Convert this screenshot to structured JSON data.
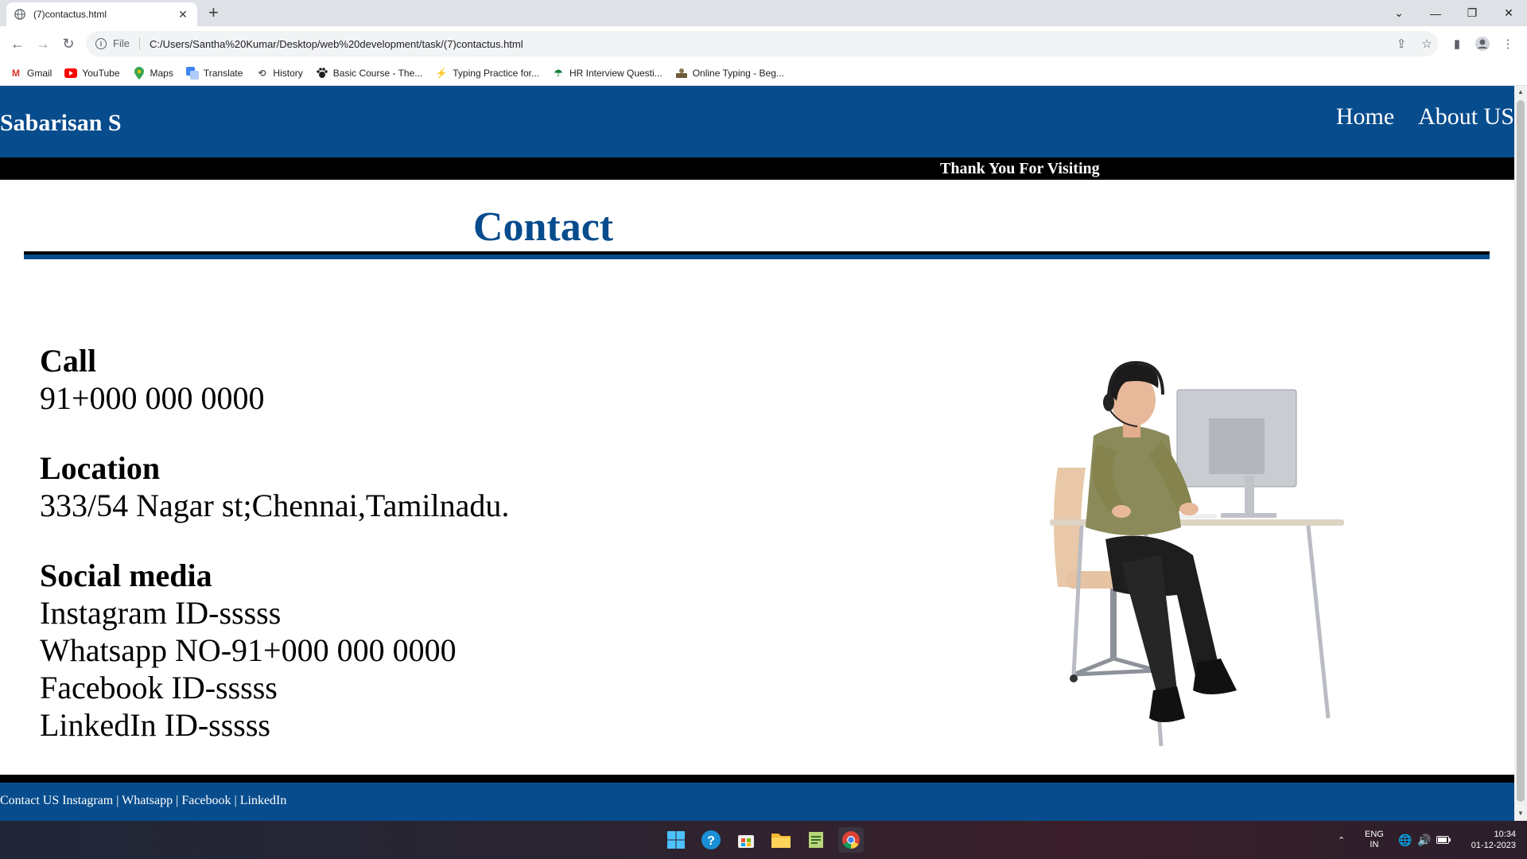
{
  "browser": {
    "tab_title": "(7)contactus.html",
    "url_scheme": "File",
    "url": "C:/Users/Santha%20Kumar/Desktop/web%20development/task/(7)contactus.html",
    "bookmarks": [
      {
        "label": "Gmail",
        "icon": "gmail-icon"
      },
      {
        "label": "YouTube",
        "icon": "youtube-icon"
      },
      {
        "label": "Maps",
        "icon": "maps-icon"
      },
      {
        "label": "Translate",
        "icon": "translate-icon"
      },
      {
        "label": "History",
        "icon": "history-icon"
      },
      {
        "label": "Basic Course - The...",
        "icon": "paw-icon"
      },
      {
        "label": "Typing Practice for...",
        "icon": "bolt-icon"
      },
      {
        "label": "HR Interview Questi...",
        "icon": "palm-icon"
      },
      {
        "label": "Online Typing - Beg...",
        "icon": "typing-icon"
      }
    ]
  },
  "site": {
    "brand": "Sabarisan S",
    "nav": [
      "Home",
      "About US"
    ],
    "ticker": "Thank You For Visiting",
    "page_title": "Contact",
    "sections": {
      "call_heading": "Call",
      "call_value": "91+000 000 0000",
      "location_heading": "Location",
      "location_value": "333/54 Nagar st;Chennai,Tamilnadu.",
      "social_heading": "Social media",
      "social_lines": [
        "Instagram ID-sssss",
        "Whatsapp NO-91+000 000 0000",
        "Facebook ID-sssss",
        "LinkedIn ID-sssss"
      ]
    },
    "footer": {
      "lead": "Contact US",
      "links": [
        "Instagram",
        "Whatsapp",
        "Facebook",
        "LinkedIn"
      ],
      "separator": "|"
    },
    "colors": {
      "primary": "#074c8d",
      "black": "#000000"
    }
  },
  "taskbar": {
    "apps": [
      "windows-start-icon",
      "help-icon",
      "store-icon",
      "file-explorer-icon",
      "notepad-icon",
      "chrome-icon"
    ],
    "lang_top": "ENG",
    "lang_bottom": "IN",
    "time": "10:34",
    "date": "01-12-2023"
  }
}
